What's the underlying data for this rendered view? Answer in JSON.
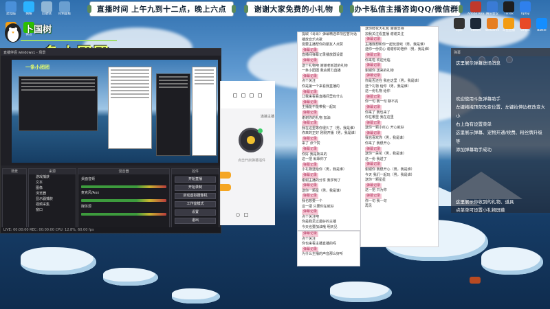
{
  "banners": {
    "schedule": "直播时间 上午九到十二点，晚上六点",
    "thanks": "谢谢大家免费的小礼物",
    "consult": "办卡私信主播咨询QQ/微信群"
  },
  "streamer": {
    "name": "卜国树",
    "group": "一条小团团"
  },
  "desktop_icons": [
    {
      "label": "此电脑"
    },
    {
      "label": "网络"
    },
    {
      "label": "回收站"
    },
    {
      "label": "控制面板"
    },
    {
      "label": "斗鱼"
    },
    {
      "label": "微信"
    }
  ],
  "tray_icons": [
    {
      "label": "Adobe Reader",
      "color": "#c0392b"
    },
    {
      "label": "腾讯会议",
      "color": "#3a7bd5"
    },
    {
      "label": "TikTok",
      "color": "#1e1e1e"
    },
    {
      "label": "Uplay",
      "color": "#2f80ed"
    },
    {
      "label": "Steam",
      "color": "#1b2838"
    },
    {
      "label": "WeGame",
      "color": "#e67e22"
    },
    {
      "label": "斗鱼直播",
      "color": "#f39c12"
    },
    {
      "label": "Origin",
      "color": "#e84a27"
    },
    {
      "label": "Battle",
      "color": "#148eff"
    },
    {
      "label": "Epic",
      "color": "#333333"
    }
  ],
  "obs": {
    "title": "直播伴侣 windows1 - 场景",
    "docks": {
      "scenes": "场景",
      "sources": "来源",
      "mixer": "混音器",
      "controls": "控件"
    },
    "sources_list": [
      "游戏捕获",
      "文本",
      "图像",
      "浏览器",
      "显示器捕获",
      "视频采集",
      "窗口"
    ],
    "mixer_channels": [
      "桌面音频",
      "麦克风/Aux",
      "媒体源"
    ],
    "control_buttons": [
      "开始直播",
      "开始录制",
      "启动虚拟摄像机",
      "工作室模式",
      "设置",
      "退出"
    ],
    "status": "LIVE: 00:00:00  REC: 00:00:00  CPU: 12.8%, 60.00 fps"
  },
  "app": {
    "rank_label": "连接主播",
    "hint": "点击开启弹幕插件"
  },
  "comment_panel_left": {
    "lines": [
      {
        "t": "提取《哥哥》弹幕精选单项应答对话",
        "hl": false
      },
      {
        "t": "播放音乐点歌",
        "hl": false
      },
      {
        "t": "需要主播帮你的朋友人点赞",
        "hl": false
      },
      {
        "t": "弹幕记录",
        "hl": true
      },
      {
        "t": "直播间弹幕记录播放器设置",
        "hl": false
      },
      {
        "t": "弹幕记录",
        "hl": true
      },
      {
        "t": "送个礼物吧 谢谢老板送的礼物",
        "hl": false
      },
      {
        "t": "一条小团团 我会努力直播",
        "hl": false
      },
      {
        "t": "弹幕记录",
        "hl": true
      },
      {
        "t": "点个关注",
        "hl": false
      },
      {
        "t": "你是第一个来看我直播的",
        "hl": false
      },
      {
        "t": "弹幕记录",
        "hl": true
      },
      {
        "t": "让我来看看直播间里有什么",
        "hl": false
      },
      {
        "t": "弹幕记录",
        "hl": true
      },
      {
        "t": "主播能不能带我一起玩",
        "hl": false
      },
      {
        "t": "弹幕记录",
        "hl": true
      },
      {
        "t": "谢谢你的礼物 加油",
        "hl": false
      },
      {
        "t": "弹幕记录",
        "hl": true
      },
      {
        "t": "我在这里等你很久了（男，我是谁）",
        "hl": false
      },
      {
        "t": "你来的正好 刚刚开播（男，我是谁）",
        "hl": false
      },
      {
        "t": "弹幕记录",
        "hl": true
      },
      {
        "t": "来了 点个赞",
        "hl": false
      },
      {
        "t": "弹幕记录",
        "hl": true
      },
      {
        "t": "你好 我是新来的",
        "hl": false
      },
      {
        "t": "这一把 就靠你了",
        "hl": false
      },
      {
        "t": "弹幕记录",
        "hl": true
      },
      {
        "t": "小礼物送给你（男，我是谁）",
        "hl": false
      },
      {
        "t": "弹幕记录",
        "hl": true
      },
      {
        "t": "谢谢主播的分享 我学到了",
        "hl": false
      },
      {
        "t": "弹幕记录",
        "hl": true
      },
      {
        "t": "送你一颗星（男，我是谁）",
        "hl": false
      },
      {
        "t": "弹幕记录",
        "hl": true
      },
      {
        "t": "我也想要一个",
        "hl": false
      },
      {
        "t": "这一把 只要你在就好",
        "hl": false
      },
      {
        "t": "弹幕记录",
        "hl": true
      },
      {
        "t": "点个关注吧",
        "hl": false
      },
      {
        "t": "你是我见过最好的主播",
        "hl": false
      },
      {
        "t": "今天也要加油哦 明天见",
        "hl": false
      }
    ]
  },
  "comment_panel_right": {
    "lines": [
      {
        "t": "送你鲜花大礼包 谢谢支持",
        "hl": false
      },
      {
        "t": "加我关注看直播 谢谢关注",
        "hl": false
      },
      {
        "t": "弹幕记录",
        "hl": true
      },
      {
        "t": "主播我想和你一起玩游戏（男，我是谁）",
        "hl": false
      },
      {
        "t": "送你一份爱心 谢谢你的陪伴（男，我是谁）",
        "hl": false
      },
      {
        "t": "弹幕记录",
        "hl": true
      },
      {
        "t": "你来啦 欢迎光临",
        "hl": false
      },
      {
        "t": "弹幕记录",
        "hl": true
      },
      {
        "t": "谢谢你 送来的礼物",
        "hl": false
      },
      {
        "t": "弹幕记录",
        "hl": true
      },
      {
        "t": "你是否还在 我在这里（男，我是谁）",
        "hl": false
      },
      {
        "t": "送个礼物 给你（男，我是谁）",
        "hl": false
      },
      {
        "t": "这一份礼物 给你",
        "hl": false
      },
      {
        "t": "弹幕记录",
        "hl": true
      },
      {
        "t": "你一句 我一句 聊不完",
        "hl": false
      },
      {
        "t": "弹幕记录",
        "hl": true
      },
      {
        "t": "你来了 我也来了",
        "hl": false
      },
      {
        "t": "你在哪里 我在这里",
        "hl": false
      },
      {
        "t": "弹幕记录",
        "hl": true
      },
      {
        "t": "送你一颗小红心 开心就好",
        "hl": false
      },
      {
        "t": "弹幕记录",
        "hl": true
      },
      {
        "t": "我也喜欢你（男，我是谁）",
        "hl": false
      },
      {
        "t": "你来了 我很开心",
        "hl": false
      },
      {
        "t": "弹幕记录",
        "hl": true
      },
      {
        "t": "送你一朵花（男，我是谁）",
        "hl": false
      },
      {
        "t": "这一份 我送了",
        "hl": false
      },
      {
        "t": "弹幕记录",
        "hl": true
      },
      {
        "t": "谢谢你 我很开心（男，我是谁）",
        "hl": false
      },
      {
        "t": "今天 我们一起玩（男，我是谁）",
        "hl": false
      },
      {
        "t": "送你一颗星星",
        "hl": false
      },
      {
        "t": "弹幕记录",
        "hl": true
      },
      {
        "t": "这一把 只为你",
        "hl": false
      },
      {
        "t": "弹幕记录",
        "hl": true
      },
      {
        "t": "你一句 我一句",
        "hl": false
      },
      {
        "t": "再见",
        "hl": false
      }
    ]
  },
  "comment_panel_bottom": {
    "lines": [
      {
        "t": "弹幕记录",
        "hl": true
      },
      {
        "t": "点个关注",
        "hl": false
      },
      {
        "t": "你也来看主播直播的吗",
        "hl": false
      },
      {
        "t": "弹幕记录",
        "hl": true
      },
      {
        "t": "为什么主播的声音那么好听",
        "hl": false
      }
    ]
  },
  "overlay": {
    "header": "弹幕",
    "line1": "这里展示弹幕进场消息",
    "line2": "欢迎使用斗鱼弹幕助手",
    "line3": "左键拖拽顶部改变位置，左键拉伸边框改变大小",
    "line4": "右上角有设置菜单",
    "line5": "这里展示弹幕、宠物开通/续费、粉丝牌升级等",
    "line6": "添加弹幕助手成功",
    "line7": "这里展示你收到的礼物、道具",
    "line8": "点菜单可设置小礼物屏蔽"
  },
  "colors": {
    "highlight_bg": "#f6c9d6",
    "highlight_fg": "#b0305a",
    "logo_text": "#e8ff6a",
    "orange_accent": "#f5a623"
  }
}
